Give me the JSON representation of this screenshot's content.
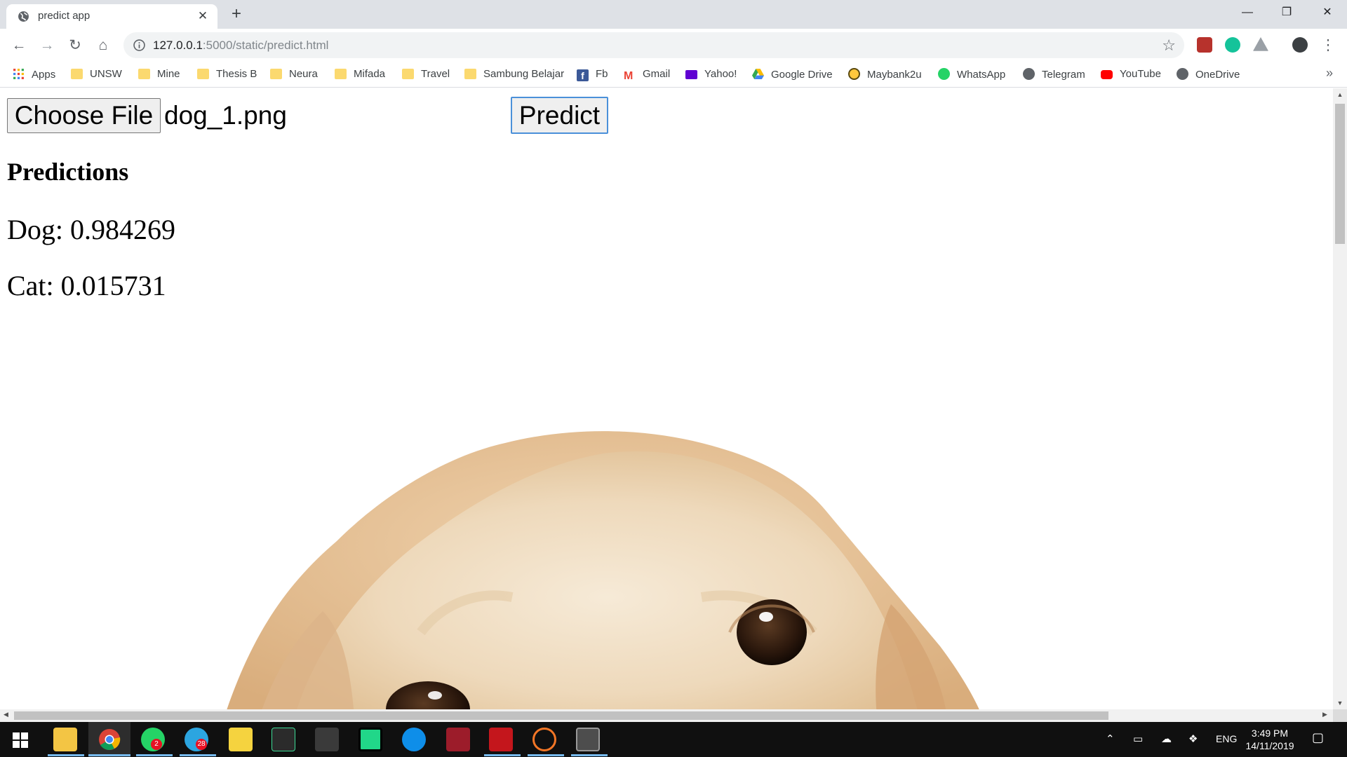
{
  "browser": {
    "tab_title": "predict app",
    "tab_close": "✕",
    "new_tab": "+",
    "url_host": "127.0.0.1",
    "url_rest": ":5000/static/predict.html",
    "window_controls": {
      "minimize": "—",
      "maximize": "❐",
      "close": "✕"
    }
  },
  "bookmarks": [
    {
      "label": "Apps",
      "icon": "apps-grid-icon"
    },
    {
      "label": "UNSW",
      "icon": "folder-icon"
    },
    {
      "label": "Mine",
      "icon": "folder-icon"
    },
    {
      "label": "Thesis B",
      "icon": "folder-icon"
    },
    {
      "label": "Neura",
      "icon": "folder-icon"
    },
    {
      "label": "Mifada",
      "icon": "folder-icon"
    },
    {
      "label": "Travel",
      "icon": "folder-icon"
    },
    {
      "label": "Sambung Belajar",
      "icon": "folder-icon"
    },
    {
      "label": "Fb",
      "icon": "facebook-icon"
    },
    {
      "label": "Gmail",
      "icon": "gmail-icon"
    },
    {
      "label": "Yahoo!",
      "icon": "yahoo-icon"
    },
    {
      "label": "Google Drive",
      "icon": "google-drive-icon"
    },
    {
      "label": "Maybank2u",
      "icon": "maybank-icon"
    },
    {
      "label": "WhatsApp",
      "icon": "whatsapp-icon"
    },
    {
      "label": "Telegram",
      "icon": "globe-icon"
    },
    {
      "label": "YouTube",
      "icon": "youtube-icon"
    },
    {
      "label": "OneDrive",
      "icon": "globe-icon"
    }
  ],
  "bookmarks_more": "»",
  "page": {
    "choose_file_label": "Choose File",
    "file_name": "dog_1.png",
    "predict_label": "Predict",
    "heading": "Predictions",
    "predictions": [
      {
        "text": "Dog: 0.984269"
      },
      {
        "text": "Cat: 0.015731"
      }
    ],
    "image_subject": "golden retriever puppy peeking"
  },
  "taskbar": {
    "language": "ENG",
    "time": "3:49 PM",
    "date": "14/11/2019",
    "whatsapp_badge": "2",
    "telegram_badge": "28"
  },
  "colors": {
    "chrome_frame": "#dee1e6",
    "omnibox": "#f1f3f4",
    "taskbar": "#101010",
    "predict_focus": "#4a90d9"
  }
}
